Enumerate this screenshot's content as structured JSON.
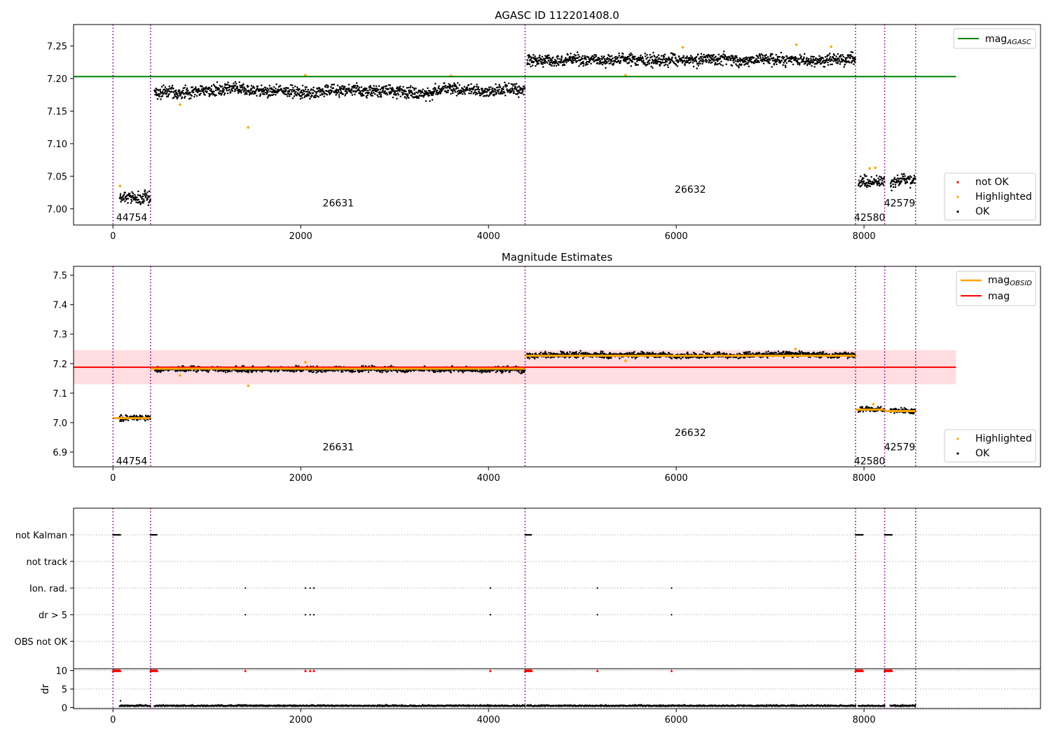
{
  "figure": {
    "title": "AGASC ID 112201408.0",
    "subtitle": "Magnitude Estimates"
  },
  "colors": {
    "ok": "#000000",
    "highlighted": "#ffa500",
    "not_ok": "#ff0000",
    "agasc_line": "#008000",
    "mag_line": "#ff0000",
    "obsid_line": "#ffa500",
    "band": "#ffdde1",
    "obsid_boundary": "#800080"
  },
  "obsid_boundaries": [
    0,
    400,
    4390,
    7910,
    8220,
    8550
  ],
  "obsid_labels": [
    {
      "text": "44754",
      "x": 200,
      "top_y": 6.987,
      "mid_y": 6.87
    },
    {
      "text": "26631",
      "x": 2400,
      "top_y": 7.009,
      "mid_y": 6.918
    },
    {
      "text": "26632",
      "x": 6150,
      "top_y": 7.03,
      "mid_y": 6.966
    },
    {
      "text": "42580",
      "x": 8060,
      "top_y": 6.987,
      "mid_y": 6.87
    },
    {
      "text": "42579",
      "x": 8380,
      "top_y": 7.009,
      "mid_y": 6.918
    }
  ],
  "chart_data": [
    {
      "type": "scatter",
      "title": "AGASC ID 112201408.0",
      "xlim": [
        -420,
        9880
      ],
      "ylim": [
        6.975,
        7.283
      ],
      "x_ticks": [
        0,
        2000,
        4000,
        6000,
        8000
      ],
      "y_ticks": [
        7.0,
        7.05,
        7.1,
        7.15,
        7.2,
        7.25
      ],
      "y_tick_labels": [
        "7.00",
        "7.05",
        "7.10",
        "7.15",
        "7.20",
        "7.25"
      ],
      "hlines": [
        {
          "name": "mag_AGASC",
          "y": 7.203,
          "x0": -420,
          "x1": 8980
        }
      ],
      "ok_segments": [
        {
          "x0": 70,
          "x1": 400,
          "center": 7.016,
          "spread": 0.006
        },
        {
          "x0": 440,
          "x1": 4390,
          "center": 7.181,
          "spread": 0.006
        },
        {
          "x0": 4410,
          "x1": 7910,
          "center": 7.229,
          "spread": 0.006
        },
        {
          "x0": 7940,
          "x1": 8220,
          "center": 7.045,
          "spread": 0.006
        },
        {
          "x0": 8280,
          "x1": 8550,
          "center": 7.04,
          "spread": 0.006
        }
      ],
      "highlighted_points": [
        [
          75,
          7.035
        ],
        [
          715,
          7.16
        ],
        [
          1440,
          7.125
        ],
        [
          2050,
          7.205
        ],
        [
          3600,
          7.204
        ],
        [
          5460,
          7.205
        ],
        [
          6070,
          7.248
        ],
        [
          7280,
          7.252
        ],
        [
          7650,
          7.249
        ],
        [
          8060,
          7.062
        ],
        [
          8120,
          7.063
        ]
      ],
      "legend": [
        "mag_AGASC",
        "not OK",
        "Highlighted",
        "OK"
      ]
    },
    {
      "type": "scatter",
      "title": "Magnitude Estimates",
      "xlim": [
        -420,
        9880
      ],
      "ylim": [
        6.85,
        7.53
      ],
      "x_ticks": [
        0,
        2000,
        4000,
        6000,
        8000
      ],
      "y_ticks": [
        6.9,
        7.0,
        7.1,
        7.2,
        7.3,
        7.4,
        7.5
      ],
      "y_tick_labels": [
        "6.9",
        "7.0",
        "7.1",
        "7.2",
        "7.3",
        "7.4",
        "7.5"
      ],
      "mag": 7.188,
      "band": [
        7.13,
        7.246
      ],
      "band_xrange": [
        -420,
        8980
      ],
      "mag_obsid_segments": [
        {
          "x0": 0,
          "x1": 400,
          "y": 7.015
        },
        {
          "x0": 400,
          "x1": 4390,
          "y": 7.183
        },
        {
          "x0": 4390,
          "x1": 7910,
          "y": 7.227
        },
        {
          "x0": 7910,
          "x1": 8220,
          "y": 7.044
        },
        {
          "x0": 8220,
          "x1": 8550,
          "y": 7.039
        }
      ],
      "highlighted_points": [
        [
          715,
          7.16
        ],
        [
          1440,
          7.125
        ],
        [
          2050,
          7.205
        ],
        [
          5460,
          7.21
        ],
        [
          7270,
          7.25
        ],
        [
          8100,
          7.062
        ]
      ],
      "legend": [
        "mag_OBSID",
        "mag",
        "Highlighted",
        "OK"
      ]
    },
    {
      "type": "scatter",
      "xlim": [
        -420,
        9880
      ],
      "categories": [
        "not Kalman",
        "not track",
        "Ion. rad.",
        "dr > 5",
        "OBS not OK"
      ],
      "flags": {
        "not Kalman": [
          [
            0,
            80
          ],
          [
            400,
            470
          ],
          [
            4390,
            4460
          ],
          [
            7910,
            7990
          ],
          [
            8220,
            8300
          ]
        ],
        "ion_rad_points": [
          1410,
          2050,
          2100,
          2140,
          4020,
          5160,
          5950
        ],
        "dr_gt_5_points": [
          1410,
          2050,
          2100,
          2140,
          4020,
          5160,
          5950
        ]
      },
      "dr": {
        "ylabel": "dr",
        "ylim": [
          -0.5,
          10.5
        ],
        "y_ticks": [
          0,
          5,
          10
        ],
        "y_tick_labels": [
          "0",
          "5",
          "10"
        ],
        "baseline": 0.35,
        "outlier": [
          [
            80,
            1.8
          ]
        ],
        "clipped_at": 10,
        "clipped_ranges": [
          [
            0,
            80
          ],
          [
            400,
            470
          ],
          [
            4390,
            4460
          ],
          [
            7910,
            7990
          ],
          [
            8220,
            8300
          ]
        ],
        "clipped_points": [
          1410,
          2050,
          2100,
          2140,
          4020,
          5160,
          5950
        ]
      }
    }
  ],
  "legends": {
    "top": [
      {
        "key": "mag_agasc",
        "base": "mag",
        "sub": "AGASC"
      },
      {
        "key": "not_ok",
        "label": "not OK"
      },
      {
        "key": "highlighted",
        "label": "Highlighted"
      },
      {
        "key": "ok",
        "label": "OK"
      }
    ],
    "mid": [
      {
        "key": "mag_obsid",
        "base": "mag",
        "sub": "OBSID"
      },
      {
        "key": "mag",
        "label": "mag"
      },
      {
        "key": "highlighted",
        "label": "Highlighted"
      },
      {
        "key": "ok",
        "label": "OK"
      }
    ]
  }
}
